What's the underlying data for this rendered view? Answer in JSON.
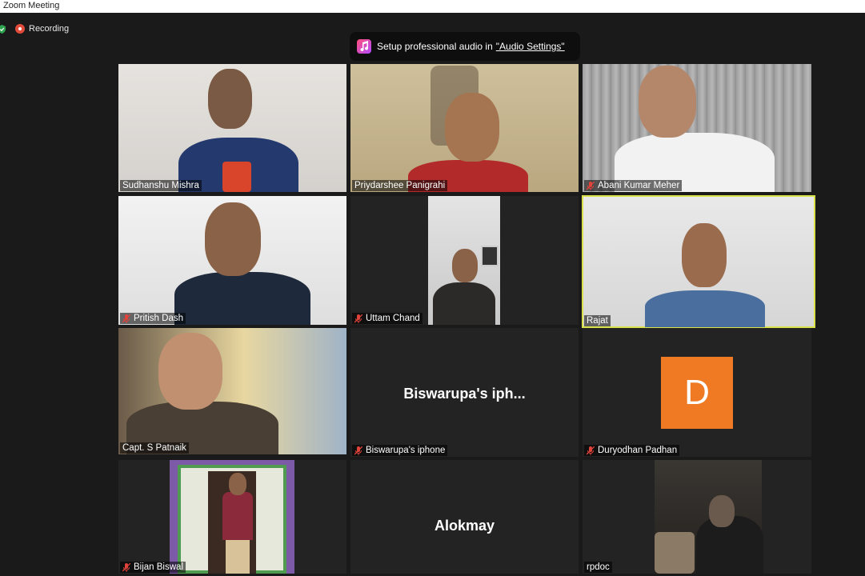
{
  "window": {
    "title": "Zoom Meeting"
  },
  "status": {
    "recording_label": "Recording"
  },
  "banner": {
    "text": "Setup professional audio in",
    "link": "\"Audio Settings\""
  },
  "participants": [
    {
      "name": "Sudhanshu Mishra",
      "muted": false
    },
    {
      "name": "Priydarshee Panigrahi",
      "muted": false
    },
    {
      "name": "Abani Kumar Meher",
      "muted": true
    },
    {
      "name": "Pritish Dash",
      "muted": true
    },
    {
      "name": "Uttam Chand",
      "muted": true
    },
    {
      "name": "Rajat",
      "muted": false,
      "active_speaker": true
    },
    {
      "name": "Capt. S Patnaik",
      "muted": false
    },
    {
      "name": "Biswarupa's  iphone",
      "display": "Biswarupa's  iph...",
      "muted": true
    },
    {
      "name": "Duryodhan Padhan",
      "avatar_letter": "D",
      "muted": true
    },
    {
      "name": "Bijan Biswal",
      "muted": true
    },
    {
      "name": "Alokmay",
      "display": "Alokmay"
    },
    {
      "name": "rpdoc",
      "muted": false
    }
  ],
  "colors": {
    "active_speaker_border": "#d9e24a",
    "avatar_bg": "#f07a23",
    "recording": "#e04b3a",
    "muted_icon": "#e0433a"
  }
}
